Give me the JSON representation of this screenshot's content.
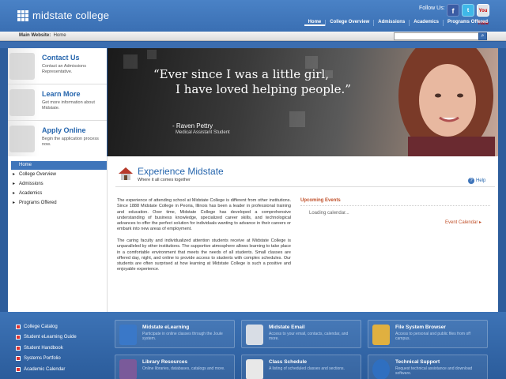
{
  "header": {
    "logo_text": "midstate college",
    "follow_label": "Follow Us:",
    "social": {
      "facebook": "f",
      "twitter": "t",
      "youtube": "You Tube"
    },
    "nav": [
      "Home",
      "College Overview",
      "Admissions",
      "Academics",
      "Programs Offered"
    ]
  },
  "subbar": {
    "label": "Main Website:",
    "location": "Home",
    "search_placeholder": "",
    "search_icon": "search-icon"
  },
  "promos": [
    {
      "title": "Contact Us",
      "desc": "Contact an Admissions Representative.",
      "icon": "phone-icon"
    },
    {
      "title": "Learn More",
      "desc": "Get more information about Midstate.",
      "icon": "info-icon"
    },
    {
      "title": "Apply Online",
      "desc": "Begin the application process now.",
      "icon": "checkmark-icon"
    }
  ],
  "hero": {
    "quote_line1": "“Ever since I was a little girl,",
    "quote_line2": "I have loved helping people.”",
    "author": "- Raven Pettry",
    "role": "Medical Assistant Student"
  },
  "sidenav": {
    "home": "Home",
    "items": [
      "College Overview",
      "Admissions",
      "Academics",
      "Programs Offered"
    ]
  },
  "content": {
    "title": "Experience Midstate",
    "subtitle": "Where it all comes together",
    "help": "Help",
    "p1": "The experience of attending school at Midstate College is different from other institutions. Since 1888 Midstate College in Peoria, Illinois has been a leader in professional training and education. Over time, Midstate College has developed a comprehensive understanding of business knowledge, specialized career skills, and technological advances to offer the perfect solution for individuals wanting to advance in their careers or embark into new areas of employment.",
    "p2": "The caring faculty and individualized attention students receive at Midstate College is unparalleled by other institutions. The supportive atmosphere allows learning to take place in a comfortable environment that meets the needs of all students. Small classes are offered day, night, and online to provide access to students with complex schedules. Our students are often surprised at how learning at Midstate College is such a positive and enjoyable experience."
  },
  "events": {
    "title": "Upcoming Events",
    "loading": "Loading calendar...",
    "calendar_link": "Event Calendar"
  },
  "footer": {
    "links": [
      "College Catalog",
      "Student eLearning Guide",
      "Student Handbook",
      "Systems Portfolio",
      "Academic Calendar"
    ],
    "tiles": [
      {
        "title": "Midstate eLearning",
        "desc": "Participate in online classes through the Joule system.",
        "icon": "book-icon",
        "color": "#3a78c8"
      },
      {
        "title": "Midstate Email",
        "desc": "Access to your email, contacts, calendar, and more.",
        "icon": "envelope-icon",
        "color": "#d8dde5"
      },
      {
        "title": "File System Browser",
        "desc": "Access to personal and public files from off campus.",
        "icon": "folder-icon",
        "color": "#e0b040"
      },
      {
        "title": "Library Resources",
        "desc": "Online libraries, databases, catalogs and more.",
        "icon": "books-icon",
        "color": "#7a5a9a"
      },
      {
        "title": "Class Schedule",
        "desc": "A listing of scheduled classes and sections.",
        "icon": "calendar-icon",
        "color": "#e8e8e8"
      },
      {
        "title": "Technical Support",
        "desc": "Request technical assistance and download software.",
        "icon": "question-icon",
        "color": "#2f6fc0"
      }
    ]
  }
}
